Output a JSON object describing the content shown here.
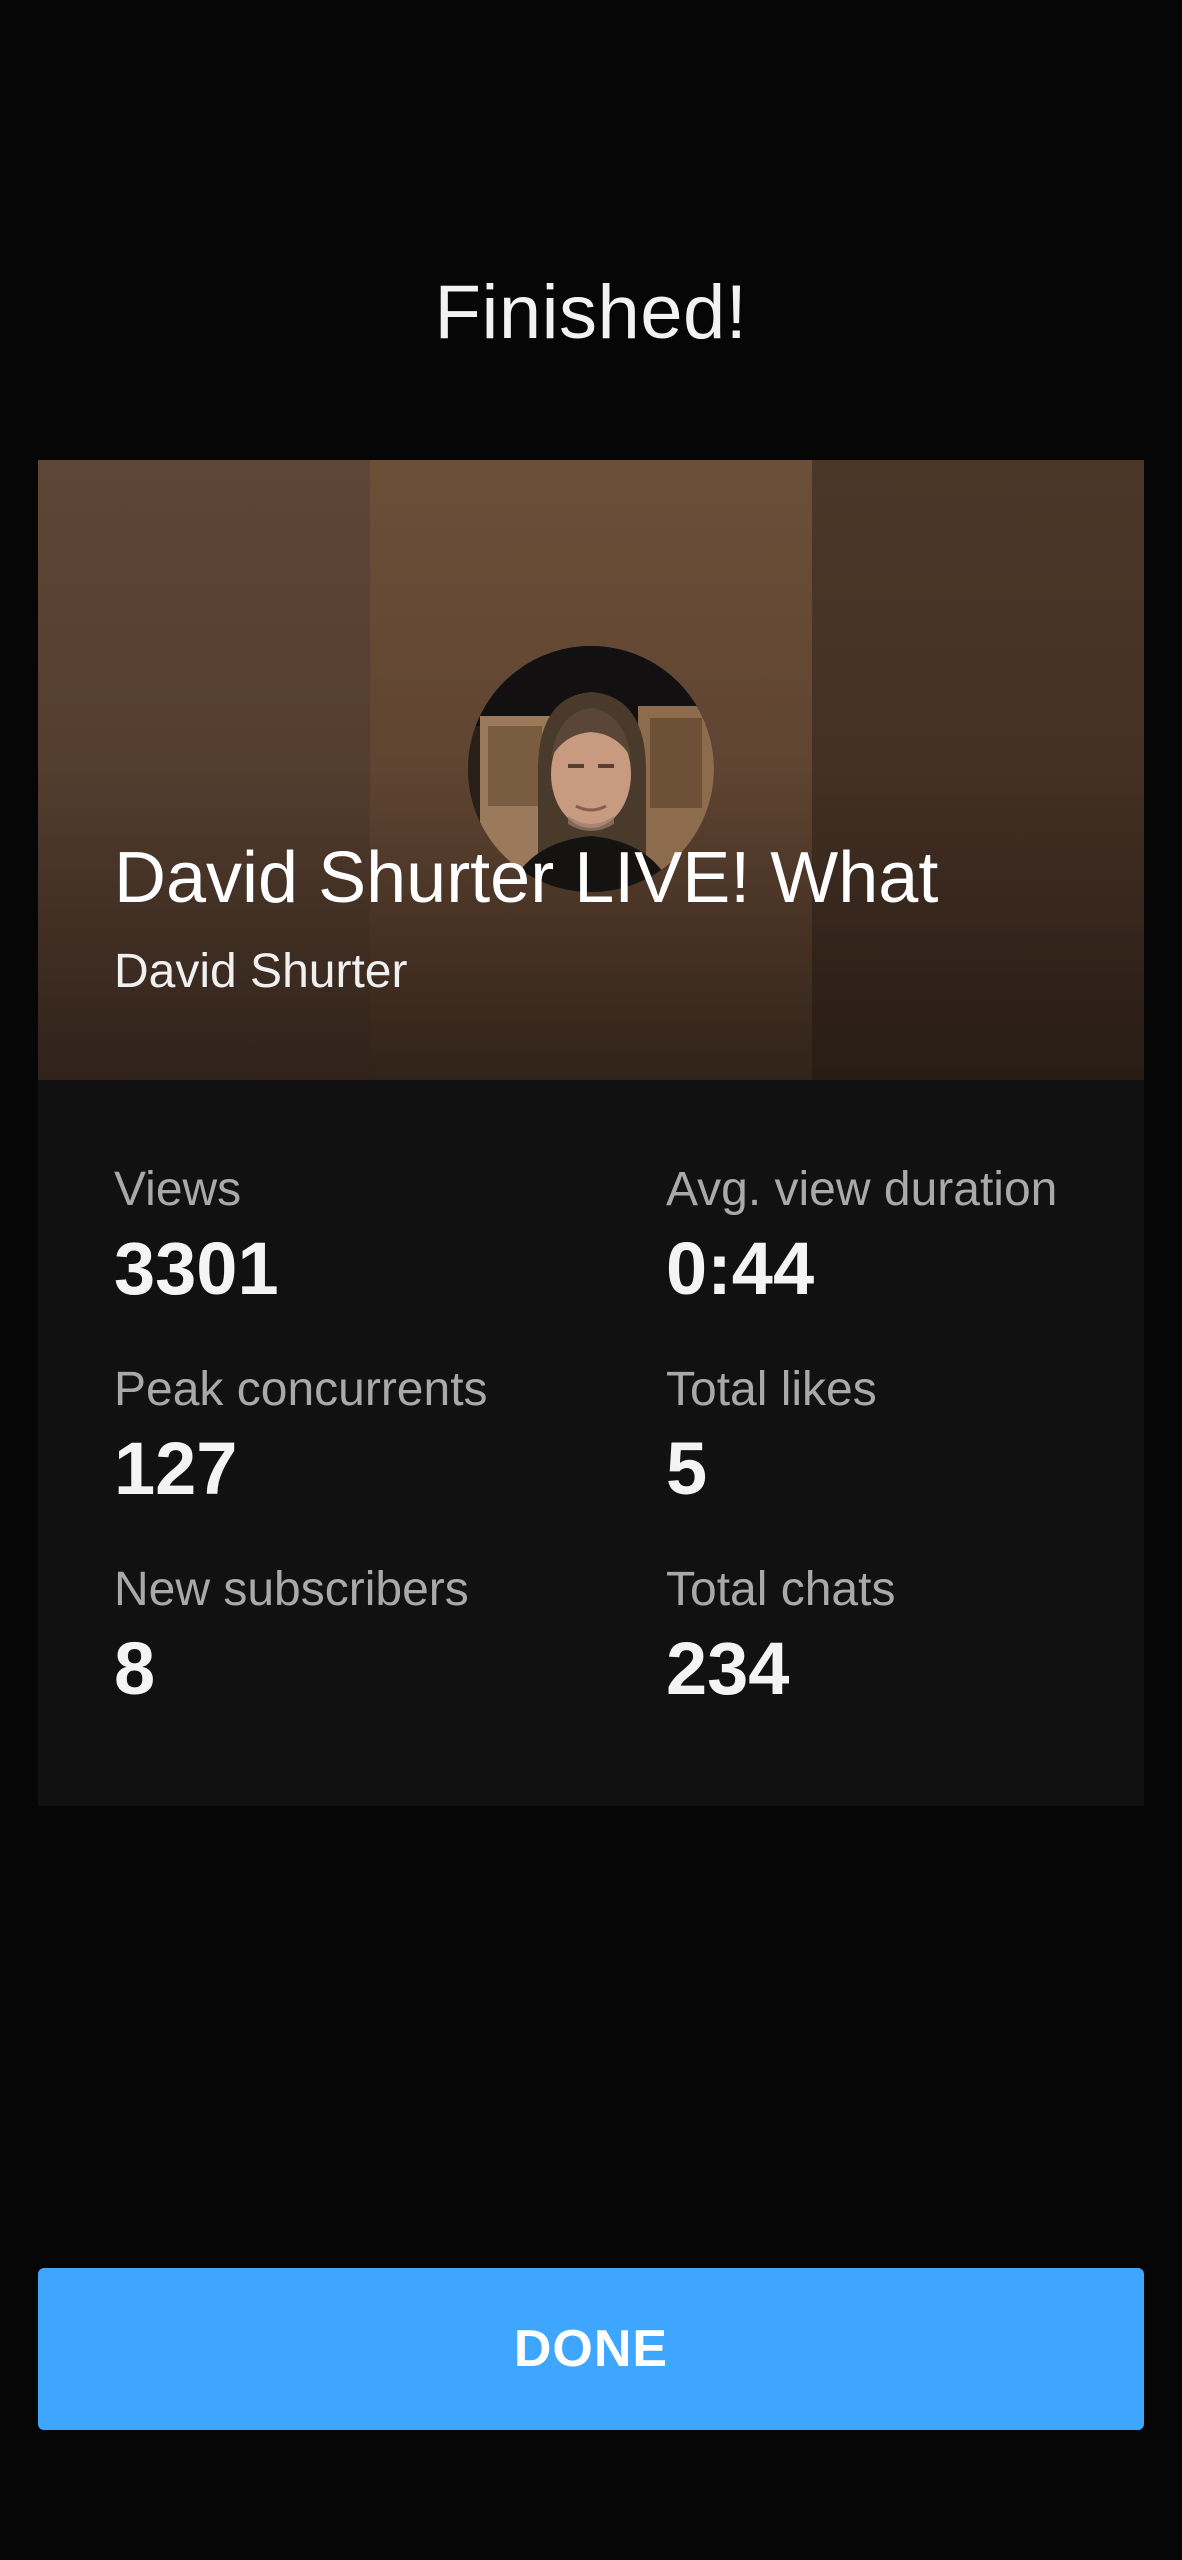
{
  "header": {
    "title": "Finished!"
  },
  "stream": {
    "title": "David Shurter LIVE! What",
    "channel": "David Shurter"
  },
  "stats": [
    {
      "label": "Views",
      "value": "3301"
    },
    {
      "label": "Avg. view duration",
      "value": "0:44"
    },
    {
      "label": "Peak concurrents",
      "value": "127"
    },
    {
      "label": "Total likes",
      "value": "5"
    },
    {
      "label": "New subscribers",
      "value": "8"
    },
    {
      "label": "Total chats",
      "value": "234"
    }
  ],
  "actions": {
    "done_label": "DONE"
  },
  "colors": {
    "background": "#060606",
    "card": "#111111",
    "accent": "#3ea6ff",
    "label": "#a9a9a9"
  }
}
